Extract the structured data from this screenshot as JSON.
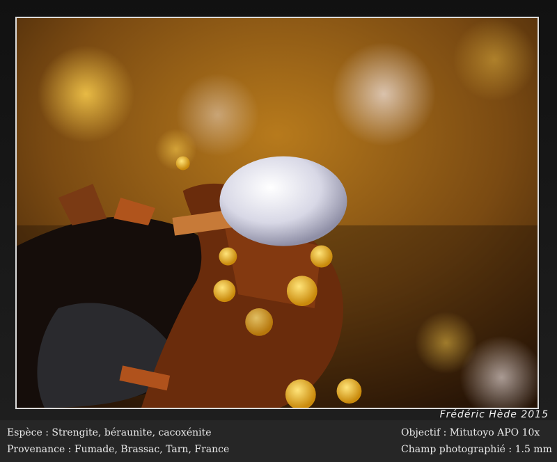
{
  "credit": "Frédéric Hède 2015",
  "caption": {
    "species": "Espèce : Strengite, béraunite, cacoxénite",
    "provenance": "Provenance : Fumade, Brassac, Tarn, France",
    "objective": "Objectif : Mitutoyo APO 10x",
    "field": "Champ photographié : 1.5 mm"
  }
}
